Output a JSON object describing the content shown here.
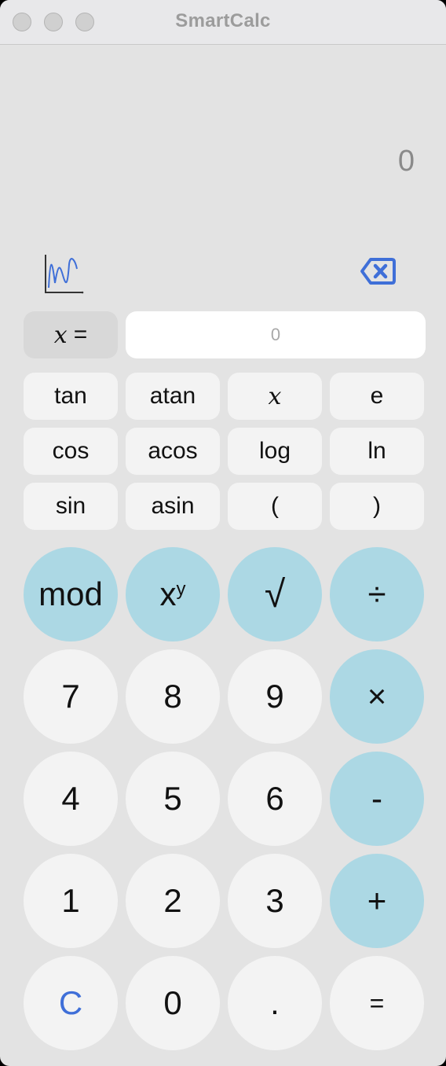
{
  "window": {
    "title": "SmartCalc"
  },
  "display": {
    "value": "0"
  },
  "icons": {
    "graph": "graph-plot-icon",
    "backspace": "backspace-icon"
  },
  "x_row": {
    "label_var": "x",
    "label_eq": "=",
    "input_placeholder": "0",
    "input_value": ""
  },
  "functions": [
    [
      "tan",
      "atan",
      "x",
      "e"
    ],
    [
      "cos",
      "acos",
      "log",
      "ln"
    ],
    [
      "sin",
      "asin",
      "(",
      ")"
    ]
  ],
  "operators_row": {
    "mod": "mod",
    "pow_base": "x",
    "pow_exp": "y",
    "sqrt": "√",
    "divide": "÷"
  },
  "keypad": {
    "row1": [
      "7",
      "8",
      "9",
      "×"
    ],
    "row2": [
      "4",
      "5",
      "6",
      "-"
    ],
    "row3": [
      "1",
      "2",
      "3",
      "+"
    ],
    "row4": [
      "C",
      "0",
      ".",
      "="
    ]
  },
  "colors": {
    "operator_bg": "#acd8e4",
    "number_bg": "#f3f3f3",
    "clear_text": "#3f6fd8",
    "window_bg": "#e3e3e3"
  }
}
